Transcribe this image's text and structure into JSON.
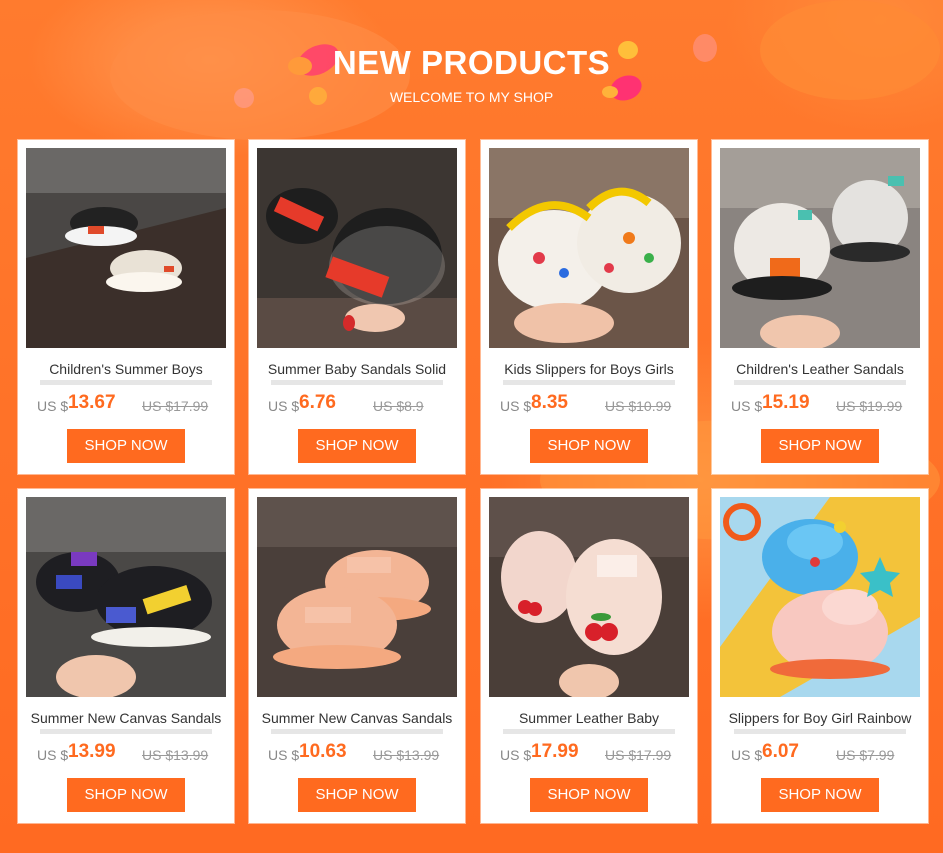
{
  "header": {
    "title": "NEW PRODUCTS",
    "subtitle": "WELCOME TO MY SHOP"
  },
  "colors": {
    "accent": "#ff6a1f",
    "background": "#ff7a2a",
    "price_text": "#ff6a1f"
  },
  "currency_prefix": "US $",
  "button_label": "SHOP NOW",
  "products": [
    {
      "name": "Children's Summer Boys",
      "price": "13.67",
      "old_price": "US $17.99"
    },
    {
      "name": "Summer Baby Sandals Solid",
      "price": "6.76",
      "old_price": "US $8.9"
    },
    {
      "name": "Kids Slippers for Boys Girls",
      "price": "8.35",
      "old_price": "US $10.99"
    },
    {
      "name": "Children's Leather Sandals",
      "price": "15.19",
      "old_price": "US $19.99"
    },
    {
      "name": "Summer New Canvas Sandals",
      "price": "13.99",
      "old_price": "US $13.99"
    },
    {
      "name": "Summer New Canvas Sandals",
      "price": "10.63",
      "old_price": "US $13.99"
    },
    {
      "name": "Summer Leather Baby",
      "price": "17.99",
      "old_price": "US $17.99"
    },
    {
      "name": "Slippers for Boy Girl Rainbow",
      "price": "6.07",
      "old_price": "US $7.99"
    }
  ]
}
